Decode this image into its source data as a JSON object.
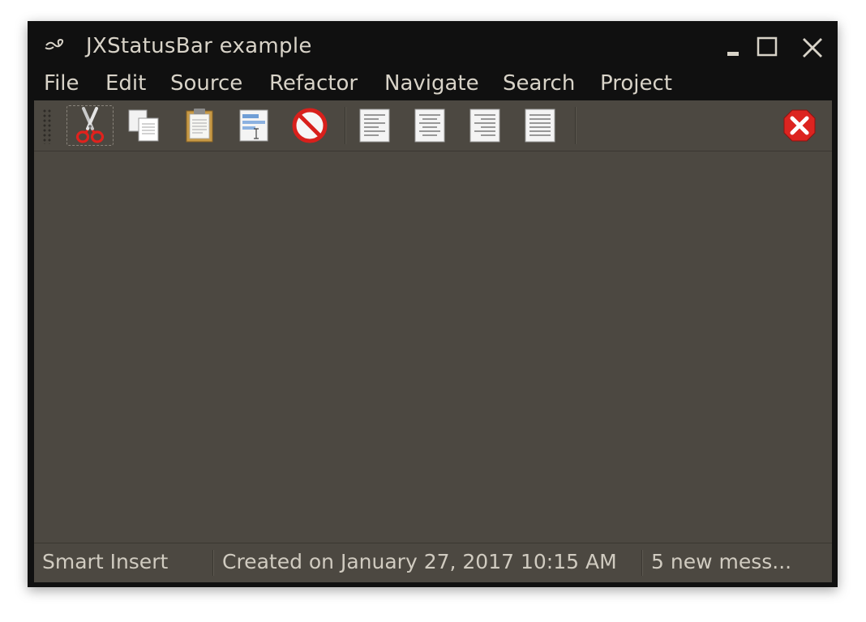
{
  "window": {
    "title": "JXStatusBar example",
    "icons": {
      "app": "java-app-icon",
      "minimize": "minimize-icon",
      "maximize": "maximize-icon",
      "close": "close-icon"
    }
  },
  "menu": {
    "items": [
      "File",
      "Edit",
      "Source",
      "Refactor",
      "Navigate",
      "Search",
      "Project"
    ]
  },
  "toolbar": {
    "buttons": [
      {
        "icon": "cut-icon",
        "selected": true
      },
      {
        "icon": "copy-icon"
      },
      {
        "icon": "paste-icon"
      },
      {
        "icon": "find-replace-icon"
      },
      {
        "icon": "stop-icon"
      },
      {
        "icon": "align-left-icon"
      },
      {
        "icon": "align-center-icon"
      },
      {
        "icon": "align-right-icon"
      },
      {
        "icon": "align-justify-icon"
      },
      {
        "icon": "exit-icon"
      }
    ]
  },
  "status": {
    "mode": "Smart Insert",
    "created": "Created on January 27, 2017 10:15 AM",
    "messages": "5 new mess..."
  },
  "colors": {
    "title_bar": "#101010",
    "panel": "#4c4841",
    "text": "#d8d3c8"
  }
}
